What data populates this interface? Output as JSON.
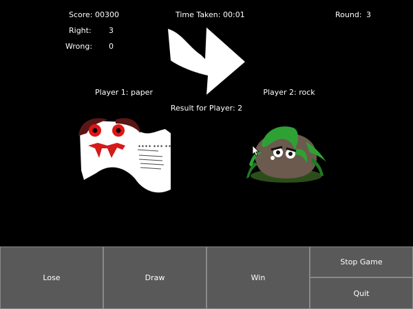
{
  "hud": {
    "score_label": "Score:",
    "score_value": "00300",
    "right_label": "Right:",
    "right_value": "3",
    "wrong_label": "Wrong:",
    "wrong_value": "0",
    "time_label": "Time Taken:",
    "time_value": "00:01",
    "round_label": "Round:",
    "round_value": "3"
  },
  "players": {
    "p1_label": "Player 1:",
    "p1_choice": "paper",
    "p2_label": "Player 2:",
    "p2_choice": "rock",
    "result_label": "Result for Player:",
    "result_value": "2"
  },
  "scene": {
    "p1_icon": "paper-monster-icon",
    "p2_icon": "rock-monster-icon",
    "arrow_icon": "curved-arrow-right-icon",
    "cursor_icon": "mouse-pointer-icon"
  },
  "buttons": {
    "lose": "Lose",
    "draw": "Draw",
    "win": "Win",
    "stop": "Stop Game",
    "quit": "Quit"
  },
  "colors": {
    "background": "#000000",
    "button": "#595959",
    "button_border": "#8a8a8a"
  }
}
